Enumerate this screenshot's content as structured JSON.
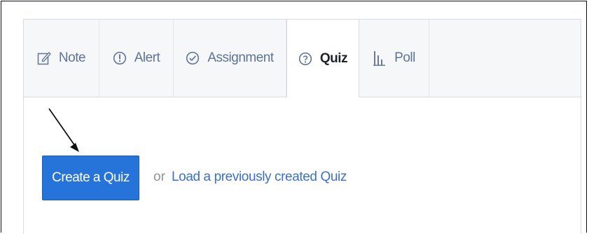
{
  "tabs": [
    {
      "label": "Note",
      "icon": "edit-icon",
      "active": false
    },
    {
      "label": "Alert",
      "icon": "alert-icon",
      "active": false
    },
    {
      "label": "Assignment",
      "icon": "check-circle-icon",
      "active": false
    },
    {
      "label": "Quiz",
      "icon": "question-circle-icon",
      "active": true
    },
    {
      "label": "Poll",
      "icon": "bar-chart-icon",
      "active": false
    }
  ],
  "content": {
    "create_button_label": "Create a Quiz",
    "or_text": "or",
    "load_link_label": "Load a previously created Quiz"
  },
  "colors": {
    "primary_button": "#2673d9",
    "link": "#3b6fc9",
    "tab_label": "#5f7297",
    "active_tab_label": "#1d2129"
  }
}
